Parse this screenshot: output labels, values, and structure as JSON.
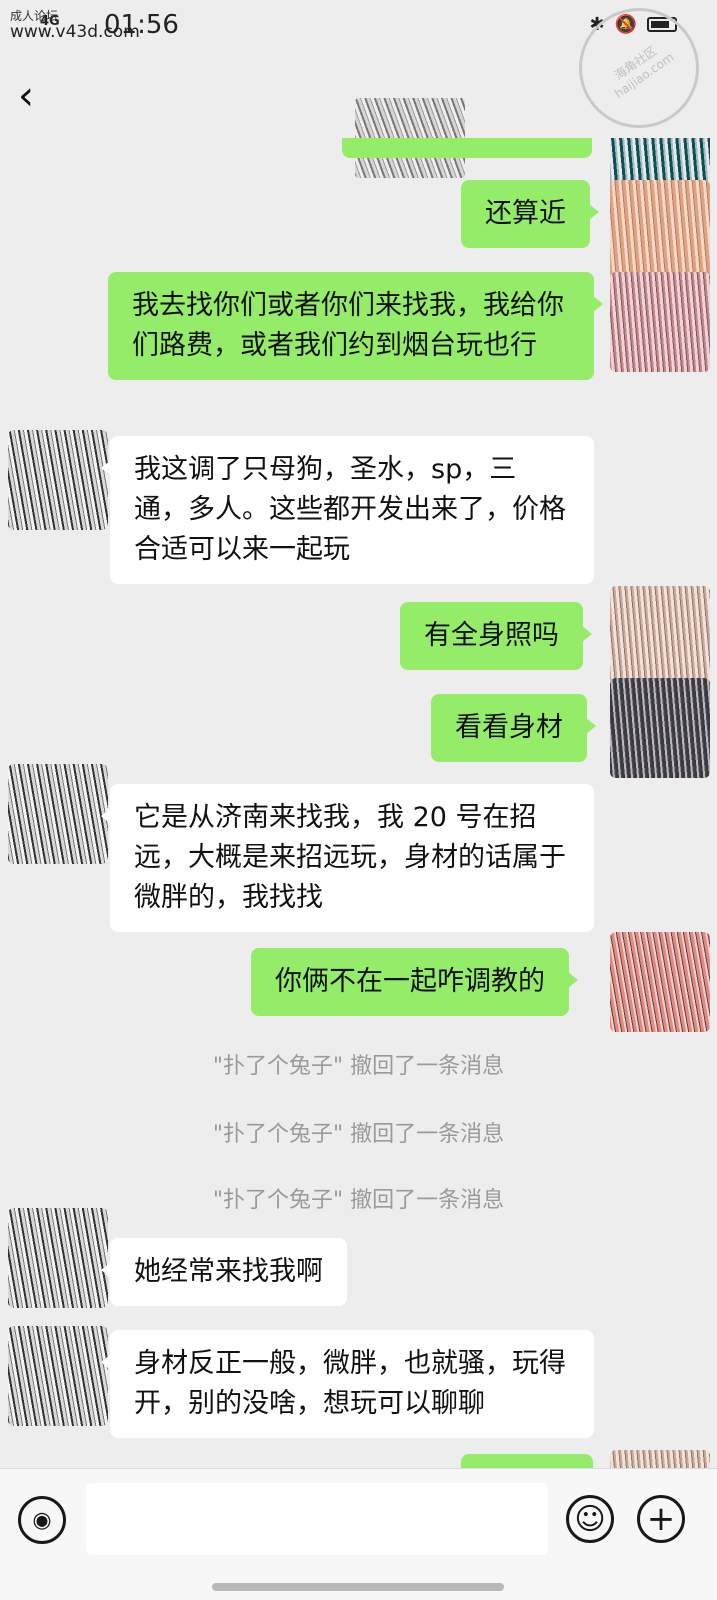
{
  "status_bar": {
    "network": "4G",
    "time": "01:56"
  },
  "watermarks": {
    "top_left_label": "成人论坛",
    "top_left_url": "www.v43d.com",
    "top_right_text": "海角社区 haijiao.com"
  },
  "nav": {
    "back_icon": "chevron-left-icon"
  },
  "messages": [
    {
      "side": "me",
      "text": "还算近"
    },
    {
      "side": "me",
      "text": "我去找你们或者你们来找我，我给你们路费，或者我们约到烟台玩也行"
    },
    {
      "side": "them",
      "text": "我这调了只母狗，圣水，sp，三通，多人。这些都开发出来了，价格合适可以来一起玩"
    },
    {
      "side": "me",
      "text": "有全身照吗"
    },
    {
      "side": "me",
      "text": "看看身材"
    },
    {
      "side": "them",
      "text": "它是从济南来找我，我 20 号在招远，大概是来招远玩，身材的话属于微胖的，我找找"
    },
    {
      "side": "me",
      "text": "你俩不在一起咋调教的"
    },
    {
      "side": "them",
      "text": "她经常来找我啊"
    },
    {
      "side": "them",
      "text": "身材反正一般，微胖，也就骚，玩得开，别的没啥，想玩可以聊聊"
    }
  ],
  "recalls": [
    "\"扑了个兔子\" 撤回了一条消息",
    "\"扑了个兔子\" 撤回了一条消息",
    "\"扑了个兔子\" 撤回了一条消息"
  ],
  "input_bar": {
    "voice_icon": "voice-icon",
    "emoji_icon": "emoji-icon",
    "add_icon": "plus-icon"
  }
}
